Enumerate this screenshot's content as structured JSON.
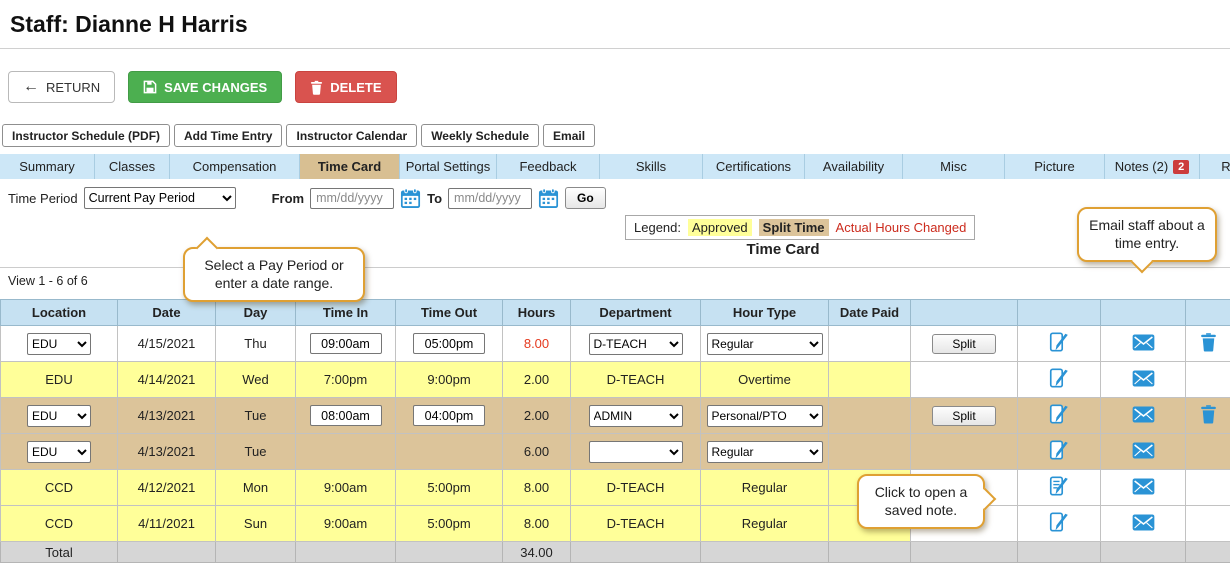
{
  "page": {
    "title": "Staff: Dianne H Harris"
  },
  "actions": {
    "return_label": "RETURN",
    "save_label": "SAVE CHANGES",
    "delete_label": "DELETE"
  },
  "toolbar": {
    "items": [
      "Instructor Schedule (PDF)",
      "Add Time Entry",
      "Instructor Calendar",
      "Weekly Schedule",
      "Email"
    ]
  },
  "tabs": {
    "items": [
      {
        "label": "Summary"
      },
      {
        "label": "Classes"
      },
      {
        "label": "Compensation"
      },
      {
        "label": "Time Card",
        "active": true
      },
      {
        "label": "Portal Settings"
      },
      {
        "label": "Feedback"
      },
      {
        "label": "Skills"
      },
      {
        "label": "Certifications"
      },
      {
        "label": "Availability"
      },
      {
        "label": "Misc"
      },
      {
        "label": "Picture"
      },
      {
        "label": "Notes (2)",
        "badge": "2"
      },
      {
        "label": "Re"
      }
    ]
  },
  "filters": {
    "time_period_label": "Time Period",
    "time_period_value": "Current Pay Period",
    "from_label": "From",
    "to_label": "To",
    "date_placeholder": "mm/dd/yyyy",
    "go_label": "Go"
  },
  "legend": {
    "label": "Legend:",
    "approved": "Approved",
    "split_time": "Split Time",
    "actual_hours": "Actual Hours Changed"
  },
  "section_title": "Time Card",
  "view_info": "View 1 - 6 of 6",
  "callouts": {
    "pay_period": "Select a Pay Period or enter a date range.",
    "email": "Email staff about a time entry.",
    "note": "Click to open a saved note."
  },
  "table": {
    "headers": [
      "Location",
      "Date",
      "Day",
      "Time In",
      "Time Out",
      "Hours",
      "Department",
      "Hour Type",
      "Date Paid",
      "",
      "",
      "",
      ""
    ],
    "split_label": "Split",
    "rows": [
      {
        "bg": "white",
        "location": {
          "type": "select",
          "value": "EDU"
        },
        "date": "4/15/2021",
        "day": "Thu",
        "time_in": {
          "type": "input",
          "value": "09:00am"
        },
        "time_out": {
          "type": "input",
          "value": "05:00pm"
        },
        "hours": "8.00",
        "hours_changed": true,
        "department": {
          "type": "select",
          "value": "D-TEACH"
        },
        "hour_type": {
          "type": "select",
          "value": "Regular"
        },
        "date_paid": "",
        "split": true,
        "note": "note",
        "email": true,
        "trash": true
      },
      {
        "bg": "approved",
        "location": {
          "type": "text",
          "value": "EDU"
        },
        "date": "4/14/2021",
        "day": "Wed",
        "time_in": {
          "type": "text",
          "value": "7:00pm"
        },
        "time_out": {
          "type": "text",
          "value": "9:00pm"
        },
        "hours": "2.00",
        "hours_changed": false,
        "department": {
          "type": "text",
          "value": "D-TEACH"
        },
        "hour_type": {
          "type": "text",
          "value": "Overtime"
        },
        "date_paid": "",
        "split": false,
        "note": "note",
        "email": true,
        "trash": false
      },
      {
        "bg": "split",
        "location": {
          "type": "select",
          "value": "EDU"
        },
        "date": "4/13/2021",
        "day": "Tue",
        "time_in": {
          "type": "input",
          "value": "08:00am"
        },
        "time_out": {
          "type": "input",
          "value": "04:00pm"
        },
        "hours": "2.00",
        "hours_changed": false,
        "department": {
          "type": "select",
          "value": "ADMIN"
        },
        "hour_type": {
          "type": "select",
          "value": "Personal/PTO"
        },
        "date_paid": "",
        "split": true,
        "note": "note",
        "email": true,
        "trash": true
      },
      {
        "bg": "split",
        "location": {
          "type": "select",
          "value": "EDU"
        },
        "date": "4/13/2021",
        "day": "Tue",
        "time_in": {
          "type": "text",
          "value": ""
        },
        "time_out": {
          "type": "text",
          "value": ""
        },
        "hours": "6.00",
        "hours_changed": false,
        "department": {
          "type": "select",
          "value": ""
        },
        "hour_type": {
          "type": "select",
          "value": "Regular"
        },
        "date_paid": "",
        "split": false,
        "note": "note",
        "email": true,
        "trash": false
      },
      {
        "bg": "approved",
        "location": {
          "type": "text",
          "value": "CCD"
        },
        "date": "4/12/2021",
        "day": "Mon",
        "time_in": {
          "type": "text",
          "value": "9:00am"
        },
        "time_out": {
          "type": "text",
          "value": "5:00pm"
        },
        "hours": "8.00",
        "hours_changed": false,
        "department": {
          "type": "text",
          "value": "D-TEACH"
        },
        "hour_type": {
          "type": "text",
          "value": "Regular"
        },
        "date_paid": "",
        "split": false,
        "note": "note-saved",
        "email": true,
        "trash": false
      },
      {
        "bg": "approved",
        "location": {
          "type": "text",
          "value": "CCD"
        },
        "date": "4/11/2021",
        "day": "Sun",
        "time_in": {
          "type": "text",
          "value": "9:00am"
        },
        "time_out": {
          "type": "text",
          "value": "5:00pm"
        },
        "hours": "8.00",
        "hours_changed": false,
        "department": {
          "type": "text",
          "value": "D-TEACH"
        },
        "hour_type": {
          "type": "text",
          "value": "Regular"
        },
        "date_paid": "",
        "split": false,
        "note": "note",
        "email": true,
        "trash": false
      }
    ],
    "total_label": "Total",
    "total_hours": "34.00"
  },
  "colors": {
    "approved_row": "#FFFF99",
    "split_row": "#DCC49A",
    "header_blue": "#C6E1F2",
    "tab_blue": "#CDE7F7",
    "active_tab_tan": "#D8BF92",
    "save_green": "#4CAF50",
    "delete_red": "#D9534F",
    "icon_blue": "#2A93D5",
    "hours_changed_red": "#E5391E",
    "callout_border_orange": "#DFA033",
    "notes_badge_red": "#CC3C3C",
    "total_row_gray": "#D6D6D6"
  },
  "icons": {
    "back_arrow": "←",
    "names": [
      "back-arrow-icon",
      "save-icon",
      "trash-icon",
      "calendar-icon",
      "note-icon",
      "note-saved-icon",
      "email-icon"
    ]
  }
}
